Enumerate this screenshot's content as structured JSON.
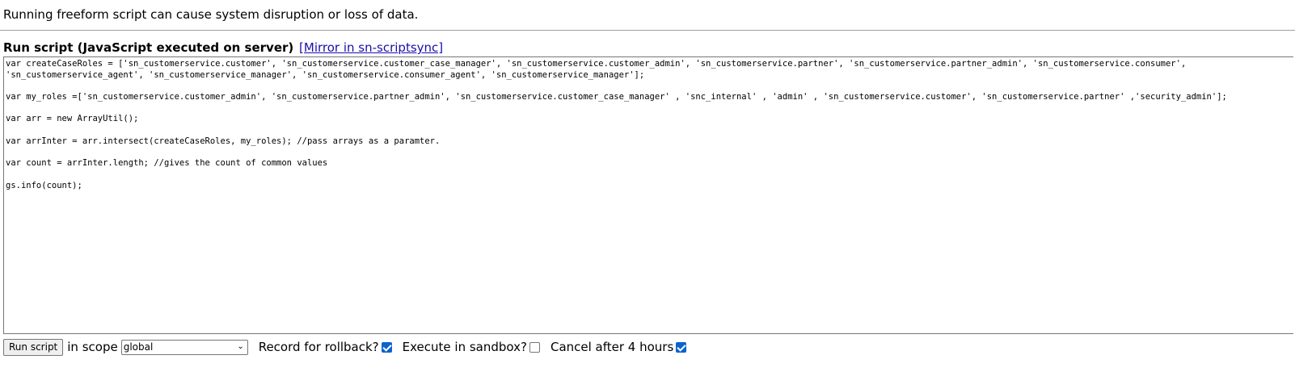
{
  "warning_text": "Running freeform script can cause system disruption or loss of data.",
  "header": {
    "title": "Run script (JavaScript executed on server)",
    "mirror_link": "[Mirror in sn-scriptsync]"
  },
  "script": {
    "lines": [
      "var createCaseRoles = ['sn_customerservice.customer', 'sn_customerservice.customer_case_manager', 'sn_customerservice.customer_admin', 'sn_customerservice.partner', 'sn_customerservice.partner_admin', 'sn_customerservice.consumer',",
      "'sn_customerservice_agent', 'sn_customerservice_manager', 'sn_customerservice.consumer_agent', 'sn_customerservice_manager'];",
      "",
      "var my_roles =['sn_customerservice.customer_admin', 'sn_customerservice.partner_admin', 'sn_customerservice.customer_case_manager' , 'snc_internal' , 'admin' , 'sn_customerservice.customer', 'sn_customerservice.partner' ,'security_admin'];",
      "",
      "var arr = new ArrayUtil();",
      "",
      "var arrInter = arr.intersect(createCaseRoles, my_roles); //pass arrays as a paramter.",
      "",
      "var count = arrInter.length; //gives the count of common values",
      "",
      "gs.info(count);"
    ]
  },
  "controls": {
    "run_button": "Run script",
    "scope_label": "in scope",
    "scope_value": "global",
    "rollback_label": "Record for rollback?",
    "rollback_checked": true,
    "sandbox_label": "Execute in sandbox?",
    "sandbox_checked": false,
    "cancel_label": "Cancel after 4 hours",
    "cancel_checked": true
  },
  "colors": {
    "link": "#1a0dab",
    "checkbox_checked": "#0b63ce"
  }
}
